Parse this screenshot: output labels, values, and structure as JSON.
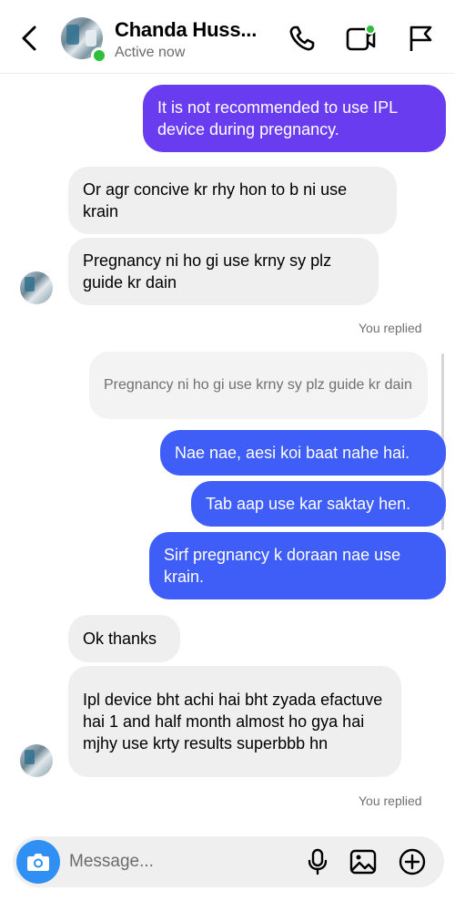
{
  "header": {
    "contact_name": "Chanda Huss...",
    "status": "Active now",
    "icons": [
      "back-icon",
      "phone-icon",
      "video-icon",
      "flag-icon"
    ]
  },
  "messages": [
    {
      "id": "m1",
      "direction": "outgoing",
      "text": "It is not recommended to use IPL device during pregnancy."
    },
    {
      "id": "m2",
      "direction": "incoming",
      "text": "Or agr concive kr rhy hon to b ni use krain"
    },
    {
      "id": "m3",
      "direction": "incoming",
      "text": "Pregnancy ni ho gi use krny sy plz guide kr dain"
    },
    {
      "id": "r1",
      "type": "reply-label",
      "text": "You replied"
    },
    {
      "id": "q1",
      "type": "reply-preview",
      "text": "Pregnancy ni ho gi use krny sy plz guide kr dain"
    },
    {
      "id": "m4",
      "direction": "outgoing",
      "text": "Nae nae, aesi koi baat nahe hai."
    },
    {
      "id": "m5",
      "direction": "outgoing",
      "text": "Tab aap use kar saktay hen."
    },
    {
      "id": "m6",
      "direction": "outgoing",
      "text": "Sirf pregnancy k doraan nae use krain."
    },
    {
      "id": "m7",
      "direction": "incoming",
      "text": "Ok thanks"
    },
    {
      "id": "m8",
      "direction": "incoming",
      "text": "Ipl device bht achi hai bht zyada efactuve hai 1 and half month almost ho gya hai mjhy use krty results superbbb hn"
    },
    {
      "id": "r2",
      "type": "reply-label",
      "text": "You replied"
    }
  ],
  "composer": {
    "placeholder": "Message...",
    "icons": [
      "camera-icon",
      "microphone-icon",
      "gallery-icon",
      "add-icon"
    ]
  },
  "colors": {
    "outgoing_blue": "#3f5ef7",
    "outgoing_purple": "#6a3cf0",
    "incoming": "#efefef",
    "online": "#2fbf3a",
    "camera": "#2f8ff3"
  }
}
